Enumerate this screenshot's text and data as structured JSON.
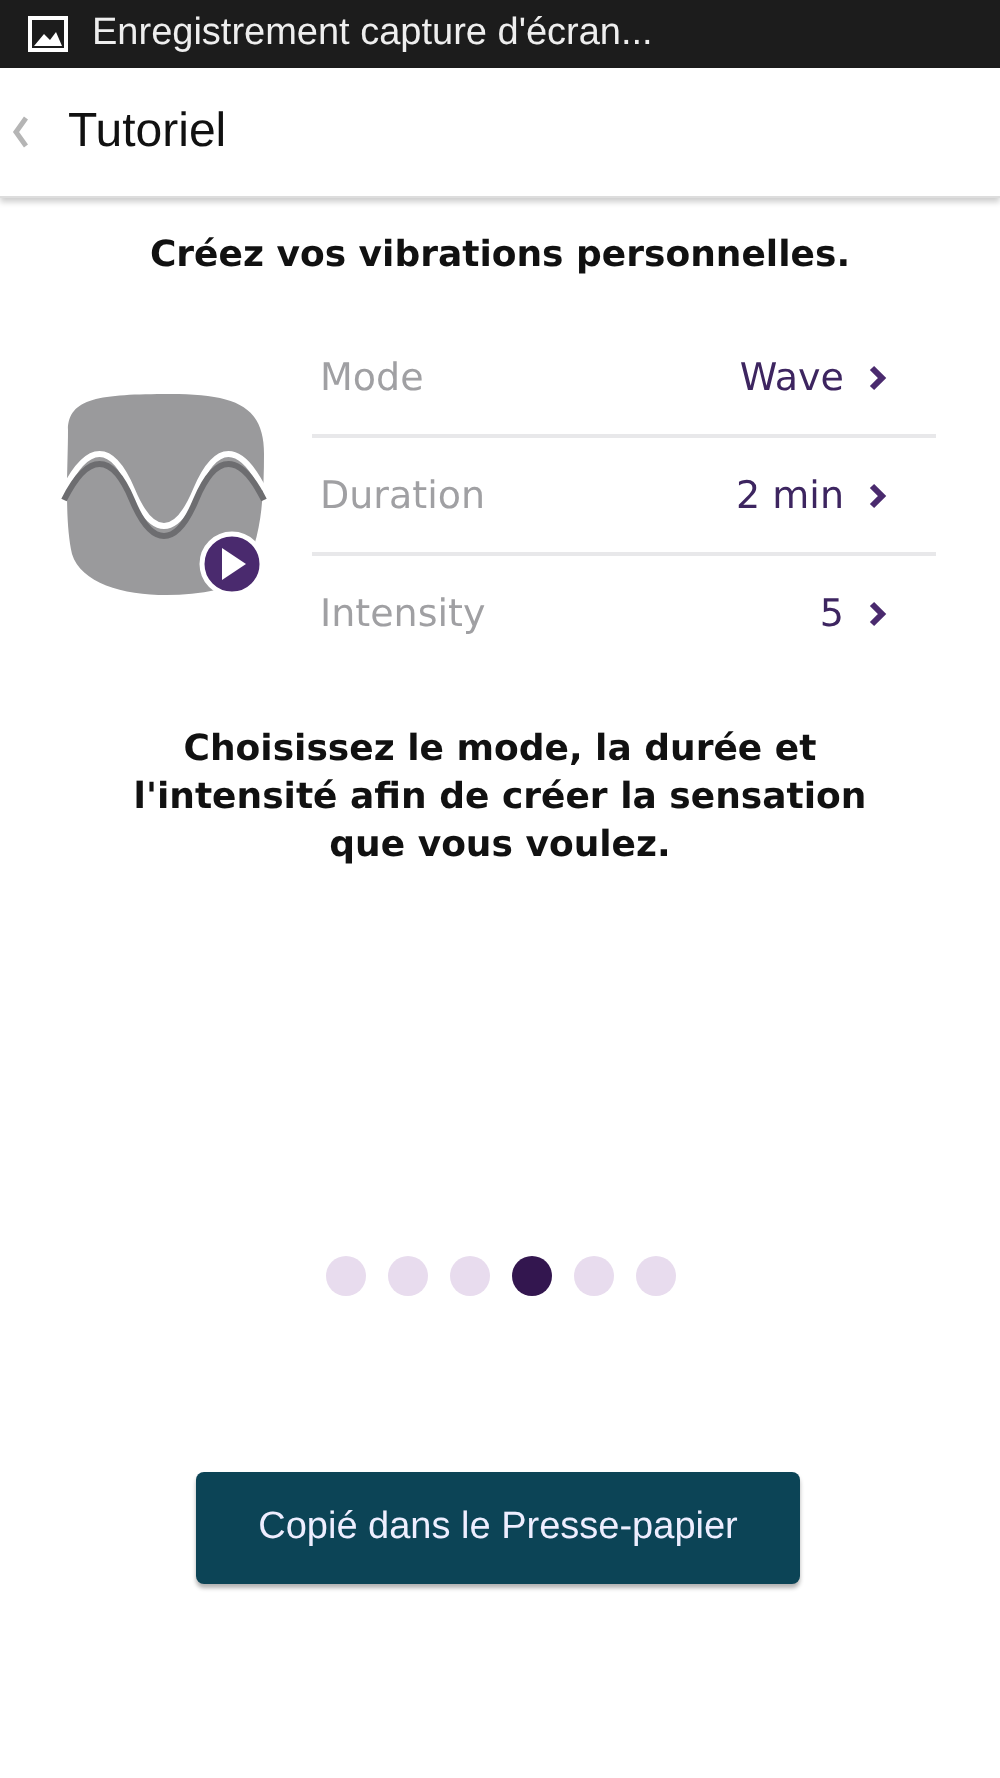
{
  "status_bar": {
    "notification": "Enregistrement capture d'écran..."
  },
  "app_bar": {
    "title": "Tutoriel"
  },
  "heading": "Créez vos vibrations personnelles.",
  "settings": [
    {
      "label": "Mode",
      "value": "Wave"
    },
    {
      "label": "Duration",
      "value": "2 min"
    },
    {
      "label": "Intensity",
      "value": "5"
    }
  ],
  "description": "Choisissez le mode, la durée et l'intensité afin de créer la sensation que vous voulez.",
  "pages": [
    {
      "selected": false
    },
    {
      "selected": false
    },
    {
      "selected": false
    },
    {
      "selected": true
    },
    {
      "selected": false
    },
    {
      "selected": false
    }
  ],
  "toast": "Copié dans le Presse-papier"
}
